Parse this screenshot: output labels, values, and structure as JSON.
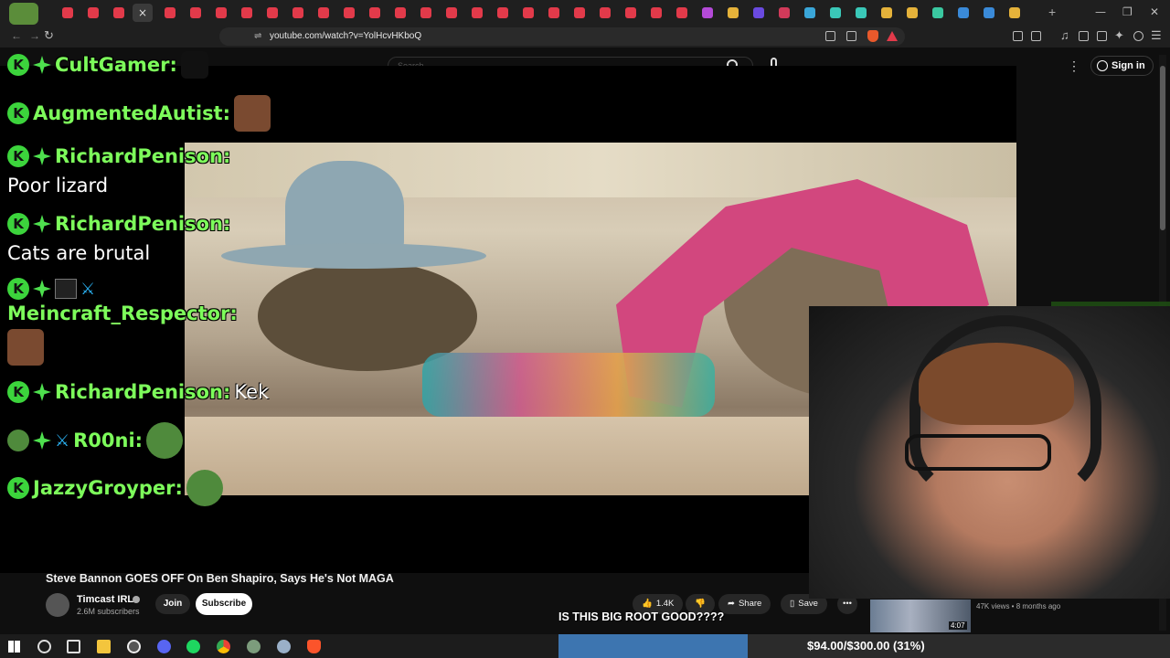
{
  "browser": {
    "url": "youtube.com/watch?v=YolHcvHKboQ",
    "tab_close_glyph": "×",
    "new_tab_glyph": "+",
    "window_controls": [
      "—",
      "❐",
      "✕"
    ]
  },
  "youtube": {
    "search_placeholder": "Search",
    "signin_label": "Sign in",
    "video_title": "Steve Bannon GOES OFF On Ben Shapiro, Says He's Not MAGA",
    "channel_name": "Timcast IRL",
    "channel_subs": "2.6M subscribers",
    "join_label": "Join",
    "subscribe_label": "Subscribe",
    "like_count": "1.4K",
    "share_label": "Share",
    "save_label": "Save",
    "more_label": "•••",
    "rec_duration": "4:07",
    "rec_meta": "47K views • 8 months ago"
  },
  "chat": [
    {
      "user": "CultGamer:",
      "msg": "",
      "emote": "pepe"
    },
    {
      "user": "AugmentedAutist:",
      "msg": "",
      "emote": "face"
    },
    {
      "user": "RichardPenison:",
      "msg": "Poor lizard"
    },
    {
      "user": "RichardPenison:",
      "msg": "Cats are brutal"
    },
    {
      "user": "Meincraft_Respector:",
      "msg": "",
      "emote": "face"
    },
    {
      "user": "RichardPenison:",
      "msg": "Kek"
    },
    {
      "user": "R00ni:",
      "msg": "",
      "emote": "pepe"
    },
    {
      "user": "JazzyGroyper:",
      "msg": "",
      "emote": "pepe"
    }
  ],
  "stream": {
    "caption": "IS THIS BIG ROOT GOOD????",
    "goal_text": "$94.00/$300.00 (31%)",
    "goal_fraction": 0.31
  },
  "colors": {
    "chat_name": "#7dfc5b",
    "badge_green": "#3cd43c",
    "goal_fill": "#3d75b0"
  }
}
